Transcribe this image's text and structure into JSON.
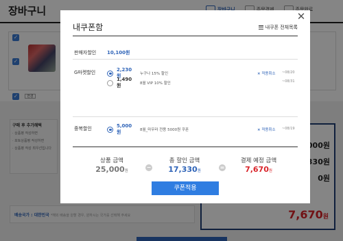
{
  "background": {
    "page_title": "장바구니",
    "steps": [
      "장바구니",
      "주문결제",
      "주문완료"
    ],
    "option_pill": "변경",
    "benefits": {
      "title": "구매 후 추가혜택",
      "lines": [
        "· 상품평 작성하면",
        "· 포토상품평 작성하면",
        "· 상품평 작성 최우선입니다"
      ]
    },
    "summary_values": [
      "000원",
      "330원",
      "0원"
    ],
    "total": "7,670",
    "total_unit": "원",
    "shipping_label": "배송국가 : 대한민국",
    "shipping_note": "*해외 배송을 원할 경우, 원하시는 국가를 선택해 주세요"
  },
  "modal": {
    "title": "내쿠폰함",
    "list_link": "내쿠폰 전체목록",
    "seller": {
      "label": "판매자할인",
      "value": "10,100원"
    },
    "gmarket": {
      "label": "G마켓할인",
      "options": [
        {
          "amount": "2,230원",
          "desc": "누구나 15% 할인",
          "selected": true,
          "cancel": "적용취소",
          "date": "~08/20"
        },
        {
          "amount": "1,490원",
          "desc": "8월 VIP 10% 할인",
          "selected": false,
          "cancel": "",
          "date": "~08/31"
        }
      ]
    },
    "duplicate": {
      "label": "중복할인",
      "options": [
        {
          "amount": "5,000원",
          "desc": "8월_마우라 전용 5000원 쿠폰",
          "selected": true,
          "cancel": "적용취소",
          "date": "~08/19"
        }
      ]
    },
    "totals": {
      "product": {
        "label": "상품 금액",
        "value": "25,000",
        "unit": "원"
      },
      "discount": {
        "label": "총 할인 금액",
        "value": "17,330",
        "unit": "원"
      },
      "payment": {
        "label": "결제 예정 금액",
        "value": "7,670",
        "unit": "원"
      }
    },
    "apply_button": "쿠폰적용"
  }
}
